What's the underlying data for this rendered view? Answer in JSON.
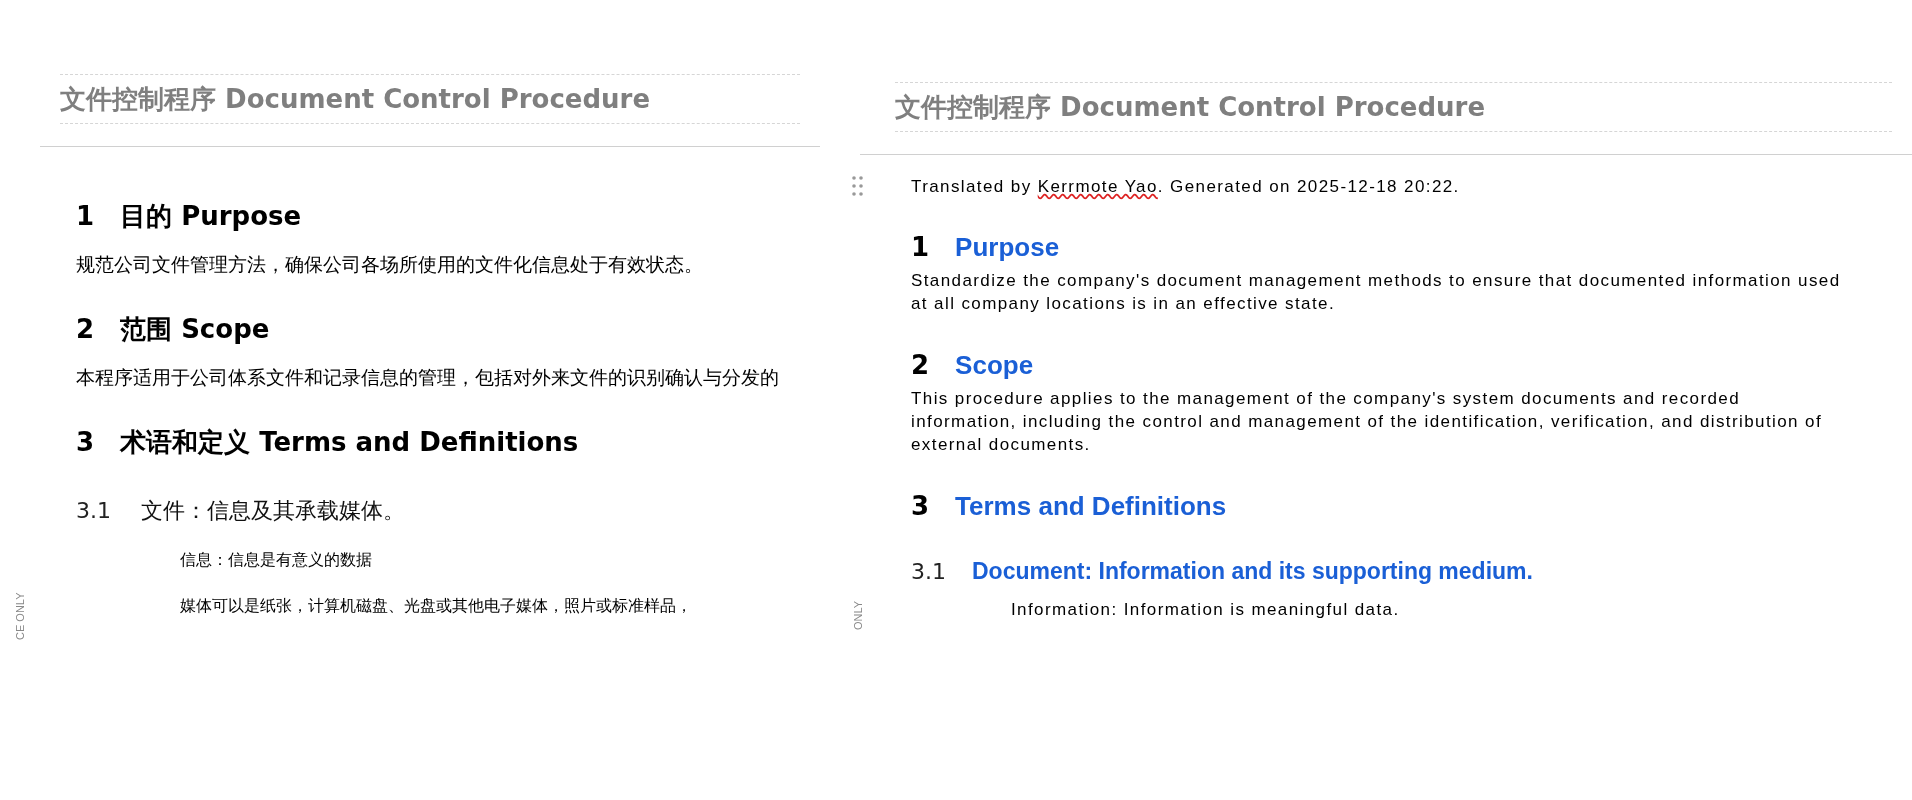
{
  "pages": [
    {
      "header_title": "文件控制程序 Document Control Procedure",
      "side_label": "CE ONLY",
      "blocks": [
        {
          "kind": "heading",
          "number": "1",
          "title": "目的 Purpose"
        },
        {
          "kind": "body",
          "text": "规范公司文件管理方法，确保公司各场所使用的文件化信息处于有效状态。"
        },
        {
          "kind": "heading",
          "number": "2",
          "title": "范围 Scope"
        },
        {
          "kind": "body",
          "text": "本程序适用于公司体系文件和记录信息的管理，包括对外来文件的识别确认与分发的"
        },
        {
          "kind": "heading",
          "number": "3",
          "title": "术语和定义 Terms and Definitions"
        },
        {
          "kind": "subheading",
          "number": "3.1",
          "title": "文件：信息及其承载媒体。"
        },
        {
          "kind": "indent",
          "text": "信息：信息是有意义的数据"
        },
        {
          "kind": "indent",
          "text": "媒体可以是纸张，计算机磁盘、光盘或其他电子媒体，照片或标准样品，"
        }
      ]
    },
    {
      "header_title": "文件控制程序 Document Control Procedure",
      "side_label": "ONLY",
      "note": {
        "before": "Translated by ",
        "flagged": "Kerrmote Yao",
        "after": ". Generated on 2025-12-18 20:22."
      },
      "blocks": [
        {
          "kind": "heading",
          "number": "1",
          "title": "Purpose"
        },
        {
          "kind": "body",
          "text": "Standardize the company's document management methods to ensure that documented information used at all company locations is in an effective state."
        },
        {
          "kind": "heading",
          "number": "2",
          "title": "Scope"
        },
        {
          "kind": "body",
          "text": "This procedure applies to the management of the company's system documents and recorded information, including the control and management of the identification, verification, and distribution of external documents."
        },
        {
          "kind": "heading",
          "number": "3",
          "title": "Terms and Definitions"
        },
        {
          "kind": "subheading",
          "number": "3.1",
          "title": "Document: Information and its supporting medium."
        },
        {
          "kind": "indent",
          "text": "Information: Information is meaningful data."
        }
      ]
    }
  ]
}
